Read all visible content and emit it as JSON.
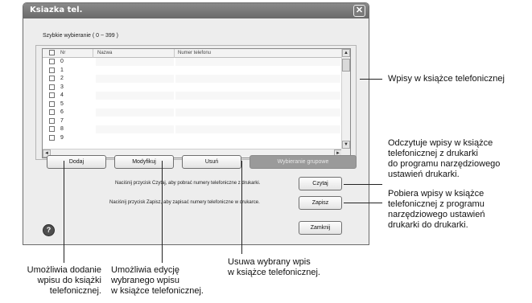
{
  "window": {
    "title": "Ksiazka tel.",
    "close_symbol": "✕"
  },
  "speed_dial_label": "Szybkie wybieranie ( 0 ~ 399 )",
  "table": {
    "columns": [
      "Nr",
      "Nazwa",
      "Numer telefonu"
    ],
    "rows": [
      {
        "nr": "0",
        "name": "",
        "phone": ""
      },
      {
        "nr": "1",
        "name": "",
        "phone": ""
      },
      {
        "nr": "2",
        "name": "",
        "phone": ""
      },
      {
        "nr": "3",
        "name": "",
        "phone": ""
      },
      {
        "nr": "4",
        "name": "",
        "phone": ""
      },
      {
        "nr": "5",
        "name": "",
        "phone": ""
      },
      {
        "nr": "6",
        "name": "",
        "phone": ""
      },
      {
        "nr": "7",
        "name": "",
        "phone": ""
      },
      {
        "nr": "8",
        "name": "",
        "phone": ""
      },
      {
        "nr": "9",
        "name": "",
        "phone": ""
      }
    ]
  },
  "buttons": {
    "add": "Dodaj",
    "modify": "Modyfikuj",
    "delete": "Usuń",
    "group_dial": "Wybieranie grupowe",
    "read": "Czytaj",
    "write": "Zapisz",
    "close": "Zamknij"
  },
  "messages": {
    "read_instruction": "Naciśnij przycisk Czytaj, aby pobrać numery telefoniczne z drukarki.",
    "write_instruction": "Naciśnij przycisk Zapisz, aby zapisać numery telefoniczne w drukarce."
  },
  "icons": {
    "help": "help-icon",
    "scroll_up": "▲",
    "scroll_down": "▼",
    "scroll_left": "◄",
    "scroll_right": "►"
  },
  "callouts": {
    "entries": "Wpisy w książce telefonicznej",
    "read": "Odczytuje wpisy w książce\ntelefonicznej z drukarki\ndo programu narzędziowego\nustawień drukarki.",
    "write": "Pobiera wpisy w książce\ntelefonicznej z programu\nnarzędziowego ustawień\ndrukarki do drukarki.",
    "add": "Umożliwia dodanie\nwpisu do książki\ntelefonicznej.",
    "modify": "Umożliwia edycję\nwybranego wpisu\nw książce telefonicznej.",
    "delete": "Usuwa wybrany wpis\nw książce telefonicznej."
  }
}
